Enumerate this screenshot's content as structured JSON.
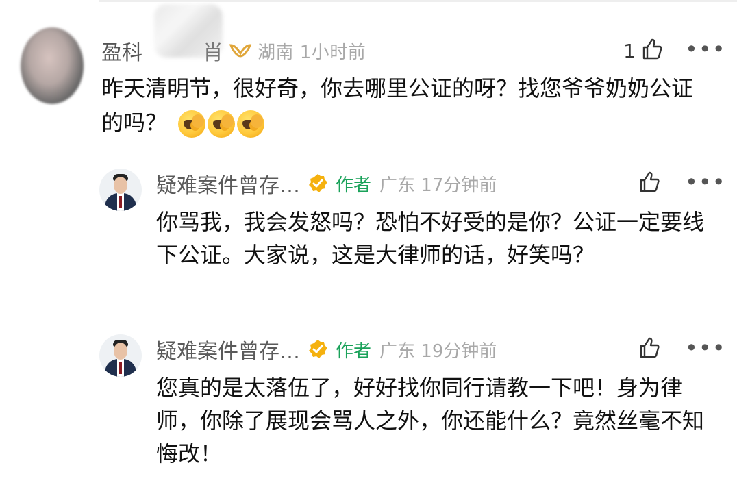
{
  "top_comment": {
    "username": "盈科",
    "username_tail": "肖",
    "meta": "湖南 1小时前",
    "like_count": "1",
    "text": "昨天清明节，很好奇，你去哪里公证的呀？找您爷爷奶奶公证的吗？",
    "emojis": [
      "cry-laugh-emoji",
      "cry-laugh-emoji",
      "cry-laugh-emoji"
    ]
  },
  "replies": [
    {
      "author": "疑难案件曾存…",
      "tag": "作者",
      "meta": "广东 17分钟前",
      "text": "你骂我，我会发怒吗？恐怕不好受的是你？公证一定要线下公证。大家说，这是大律师的话，好笑吗？"
    },
    {
      "author": "疑难案件曾存…",
      "tag": "作者",
      "meta": "广东 19分钟前",
      "text": "您真的是太落伍了，好好找你同行请教一下吧！身为律师，你除了展现会骂人之外，你还能什么？竟然丝毫不知悔改！"
    }
  ],
  "icons": {
    "like": "thumbs-up-icon",
    "more": "more-icon",
    "verified": "verified-badge-icon",
    "vip": "vip-badge-icon"
  },
  "colors": {
    "author_tag": "#1aa25a",
    "verified_badge": "#f5b10f",
    "meta_text": "#a8a8a8"
  }
}
